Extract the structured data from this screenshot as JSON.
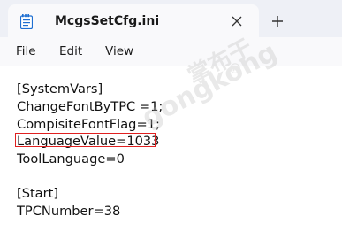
{
  "tab": {
    "title": "McgsSetCfg.ini",
    "close_glyph": "✕",
    "new_tab_glyph": "+",
    "icon": "notepad-file-icon"
  },
  "menu": {
    "items": [
      {
        "label": "File"
      },
      {
        "label": "Edit"
      },
      {
        "label": "View"
      }
    ]
  },
  "editor": {
    "lines": [
      "[SystemVars]",
      "ChangeFontByTPC =1;",
      "CompisiteFontFlag=1;",
      "LanguageValue=1033",
      "ToolLanguage=0",
      "",
      "[Start]",
      "TPCNumber=38"
    ]
  },
  "watermark": {
    "cn": "掌布于",
    "en": "gongkong",
    "registered": "®"
  },
  "colors": {
    "highlight_border": "#e02020",
    "tabbar_bg": "#eef0f6",
    "icon_blue": "#1f6fd1"
  }
}
